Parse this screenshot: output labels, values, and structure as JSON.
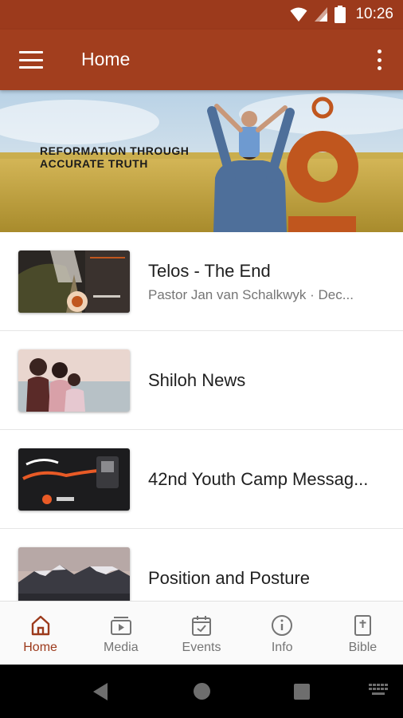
{
  "status_bar": {
    "time": "10:26"
  },
  "app_bar": {
    "title": "Home"
  },
  "banner": {
    "text": "REFORMATION THROUGH ACCURATE TRUTH"
  },
  "items": [
    {
      "title": "Telos - The End",
      "subtitle": "Pastor Jan van Schalkwyk · Dec..."
    },
    {
      "title": "Shiloh News",
      "subtitle": ""
    },
    {
      "title": "42nd Youth Camp Messag...",
      "subtitle": ""
    },
    {
      "title": "Position and Posture",
      "subtitle": ""
    }
  ],
  "bottom_nav": [
    {
      "label": "Home",
      "icon": "home-icon",
      "active": true
    },
    {
      "label": "Media",
      "icon": "media-icon",
      "active": false
    },
    {
      "label": "Events",
      "icon": "calendar-check-icon",
      "active": false
    },
    {
      "label": "Info",
      "icon": "info-icon",
      "active": false
    },
    {
      "label": "Bible",
      "icon": "bible-icon",
      "active": false
    }
  ],
  "colors": {
    "accent": "#a23e1e",
    "status_bar": "#9c3a1c",
    "nav_active": "#9c3a1c",
    "nav_inactive": "#757575"
  }
}
